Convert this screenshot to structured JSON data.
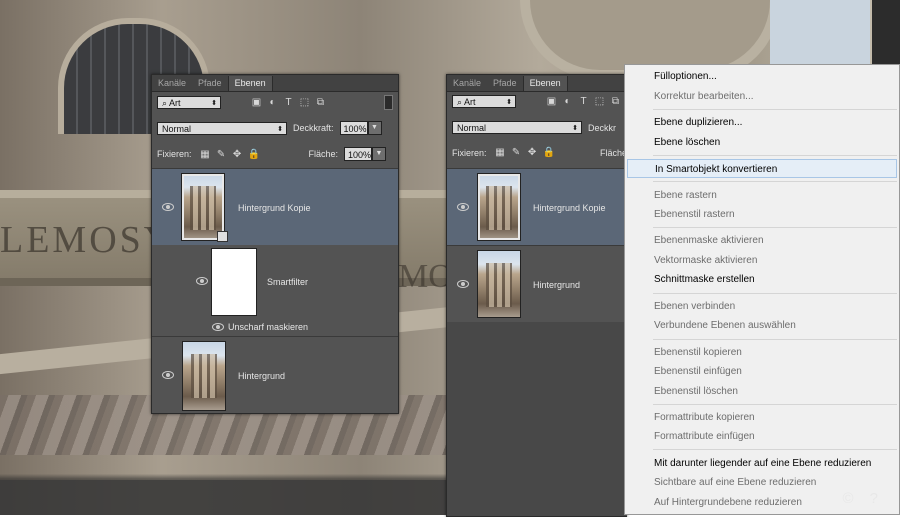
{
  "panel_tabs": [
    "Kanäle",
    "Pfade",
    "Ebenen"
  ],
  "filter_kind": "Art",
  "blend_mode": "Normal",
  "opacity_label": "Deckkraft:",
  "opacity_value": "100%",
  "lock_label": "Fixieren:",
  "fill_label": "Fläche:",
  "fill_value": "100%",
  "left_layers": {
    "copy": "Hintergrund Kopie",
    "smartfilter": "Smartfilter",
    "effect": "Unscharf maskieren",
    "background": "Hintergrund"
  },
  "right_layers": {
    "copy": "Hintergrund Kopie",
    "background": "Hintergrund"
  },
  "right_fill_label": "Fläche",
  "right_opacity_label": "Deckkr",
  "context_menu": [
    {
      "label": "Fülloptionen...",
      "enabled": true
    },
    {
      "label": "Korrektur bearbeiten...",
      "enabled": false
    },
    {
      "label": "Ebene duplizieren...",
      "enabled": true
    },
    {
      "label": "Ebene löschen",
      "enabled": true
    },
    {
      "label": "In Smartobjekt konvertieren",
      "enabled": true,
      "highlighted": true
    },
    {
      "label": "Ebene rastern",
      "enabled": false
    },
    {
      "label": "Ebenenstil rastern",
      "enabled": false
    },
    {
      "label": "Ebenenmaske aktivieren",
      "enabled": false
    },
    {
      "label": "Vektormaske aktivieren",
      "enabled": false
    },
    {
      "label": "Schnittmaske erstellen",
      "enabled": true
    },
    {
      "label": "Ebenen verbinden",
      "enabled": false
    },
    {
      "label": "Verbundene Ebenen auswählen",
      "enabled": false
    },
    {
      "label": "Ebenenstil kopieren",
      "enabled": false
    },
    {
      "label": "Ebenenstil einfügen",
      "enabled": false
    },
    {
      "label": "Ebenenstil löschen",
      "enabled": false
    },
    {
      "label": "Formattribute kopieren",
      "enabled": false
    },
    {
      "label": "Formattribute einfügen",
      "enabled": false
    },
    {
      "label": "Mit darunter liegender auf eine Ebene reduzieren",
      "enabled": true
    },
    {
      "label": "Sichtbare auf eine Ebene reduzieren",
      "enabled": false
    },
    {
      "label": "Auf Hintergrundebene reduzieren",
      "enabled": false
    }
  ],
  "background_text": {
    "left": "LEMOSYN",
    "right": "MO"
  },
  "corner_icons": "© ?"
}
